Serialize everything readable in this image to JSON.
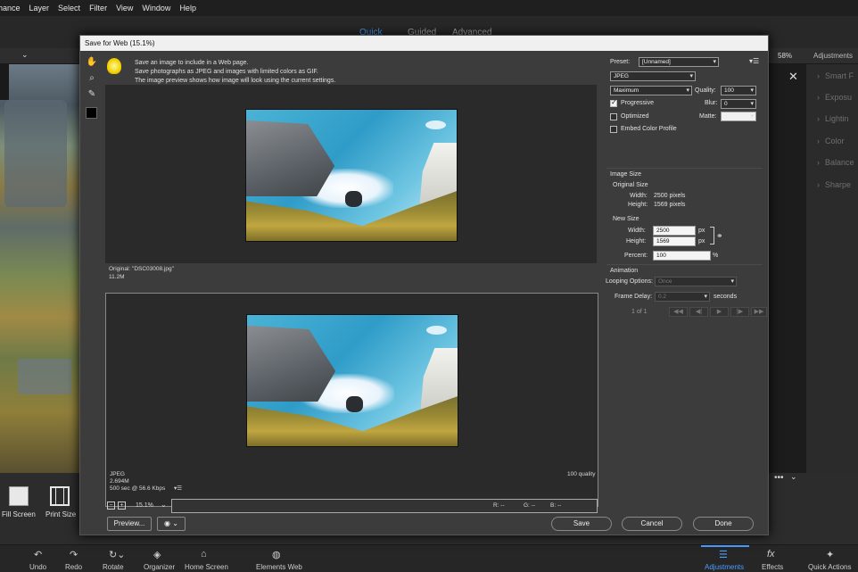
{
  "menubar": {
    "items": [
      "hance",
      "Layer",
      "Select",
      "Filter",
      "View",
      "Window",
      "Help"
    ]
  },
  "modes": {
    "quick": "Quick",
    "guided": "Guided",
    "advanced": "Advanced"
  },
  "optbar": {
    "zoom": "58%",
    "adjustments": "Adjustments"
  },
  "rightpanel": {
    "items": [
      "Smart F",
      "Exposu",
      "Lightin",
      "Color",
      "Balance",
      "Sharpe"
    ]
  },
  "bottomtools": {
    "fill_screen": "Fill Screen",
    "print_size": "Print Size"
  },
  "taskbar": {
    "undo": "Undo",
    "redo": "Redo",
    "rotate": "Rotate",
    "organizer": "Organizer",
    "home": "Home Screen",
    "elements_web": "Elements Web",
    "adjustments": "Adjustments",
    "effects": "Effects",
    "quick_actions": "Quick Actions"
  },
  "dialog": {
    "title": "Save for Web (15.1%)",
    "tip_lines": [
      "Save an image to include in a Web page.",
      "Save photographs as JPEG and images with limited colors as GIF.",
      "The image preview shows how image will look using the current settings."
    ],
    "original": {
      "name": "Original: \"DSC03008.jpg\"",
      "size": "11.2M"
    },
    "optimized": {
      "format": "JPEG",
      "size": "2.694M",
      "time": "500 sec @ 56.6 Kbps",
      "quality_note": "100 quality"
    },
    "zoom": "15.1%",
    "rgb": {
      "r": "R: --",
      "g": "G: --",
      "b": "B: --"
    },
    "buttons": {
      "preview": "Preview...",
      "save": "Save",
      "cancel": "Cancel",
      "done": "Done"
    },
    "preset_label": "Preset:",
    "preset_value": "[Unnamed]",
    "format_value": "JPEG",
    "quality_level": "Maximum",
    "quality_label": "Quality:",
    "quality_value": "100",
    "progressive": "Progressive",
    "optimized_lbl": "Optimized",
    "embed": "Embed Color Profile",
    "blur_label": "Blur:",
    "blur_value": "0",
    "matte_label": "Matte:",
    "image_size": "Image Size",
    "original_size": "Original Size",
    "orig_width_label": "Width:",
    "orig_width": "2500 pixels",
    "orig_height_label": "Height:",
    "orig_height": "1569 pixels",
    "new_size": "New Size",
    "new_width_label": "Width:",
    "new_width": "2500",
    "new_height_label": "Height:",
    "new_height": "1569",
    "px": "px",
    "percent_label": "Percent:",
    "percent_value": "100",
    "percent_unit": "%",
    "animation": "Animation",
    "looping_label": "Looping Options:",
    "looping_value": "Once",
    "frame_delay_label": "Frame Delay:",
    "frame_delay_value": "0.2",
    "seconds": "seconds",
    "frame_counter": "1 of 1"
  },
  "colors": {
    "accent": "#4a9eff",
    "dialog_bg": "#3c3c3c",
    "pane_bg": "#2a2a2a"
  },
  "icons": [
    "hand-icon",
    "zoom-icon",
    "eyedropper-icon",
    "color-swatch-icon",
    "lightbulb-icon",
    "link-icon",
    "chevron-down-icon",
    "close-icon",
    "browser-icon",
    "menu-icon"
  ]
}
